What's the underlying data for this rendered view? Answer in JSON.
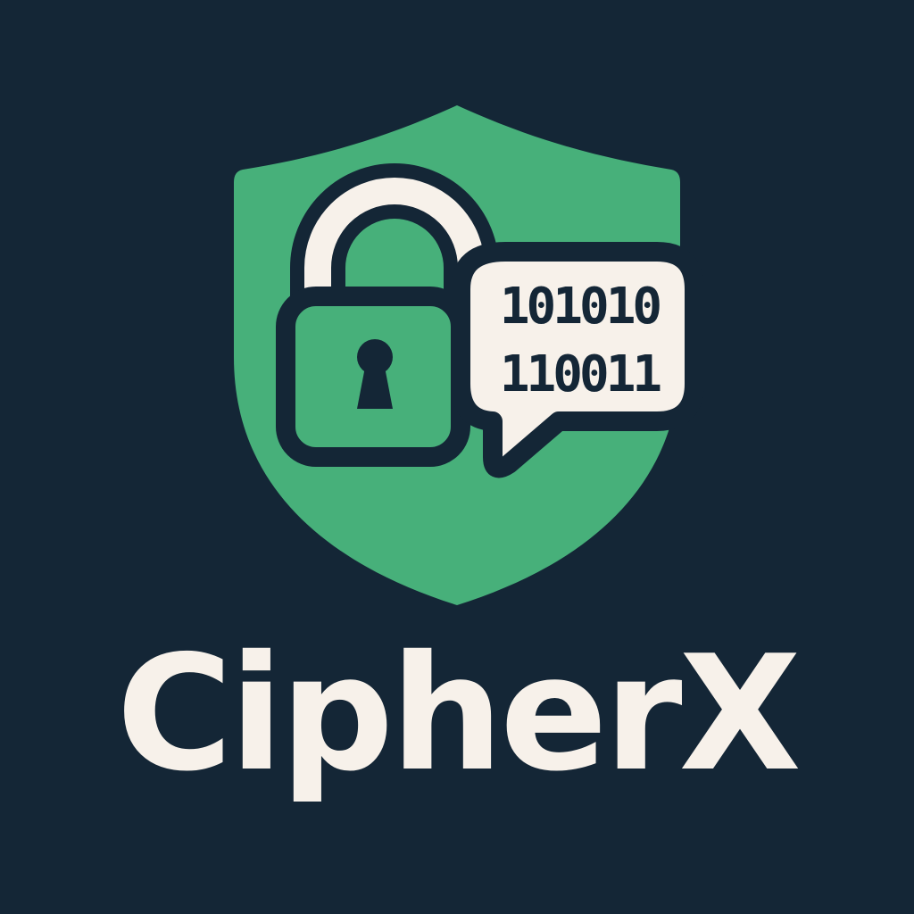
{
  "brand": {
    "name": "CipherX"
  },
  "emblem": {
    "icons": [
      "shield-icon",
      "padlock-icon",
      "keyhole-icon",
      "speech-bubble-icon"
    ],
    "binary_lines": [
      "101010",
      "110011"
    ]
  },
  "colors": {
    "background": "#142636",
    "shield_green": "#47b07a",
    "outline_dark": "#142636",
    "cream": "#f7f1ea"
  }
}
